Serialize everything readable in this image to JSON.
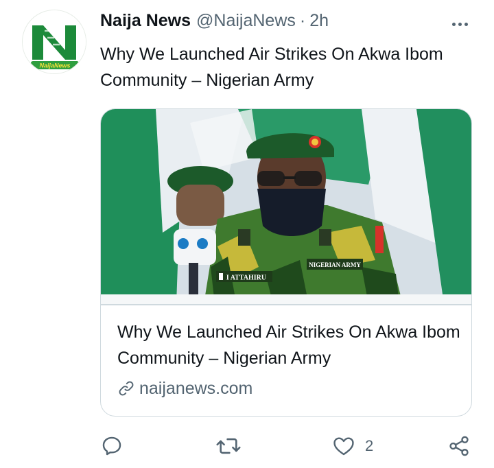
{
  "author": {
    "name": "Naija News",
    "handle": "@NaijaNews",
    "separator": "·",
    "time": "2h",
    "avatar_text": "NaijaNews"
  },
  "tweet": {
    "text": "Why We Launched Air Strikes On Akwa Ibom Community – Nigerian Army"
  },
  "card": {
    "title": "Why We Launched Air Strikes On Akwa Ibom Community – Nigerian Army",
    "domain": "naijanews.com",
    "domain_icon": "link-icon",
    "image_labels": {
      "name_tag": "I ATTAHIRU",
      "army_tag": "NIGERIAN ARMY"
    }
  },
  "actions": {
    "reply_icon": "reply-icon",
    "retweet_icon": "retweet-icon",
    "like_icon": "heart-icon",
    "like_count": "2",
    "share_icon": "share-icon"
  },
  "colors": {
    "text_primary": "#0f1419",
    "text_secondary": "#536471",
    "border": "#cfd9de",
    "brand_green": "#1c8a3a"
  }
}
